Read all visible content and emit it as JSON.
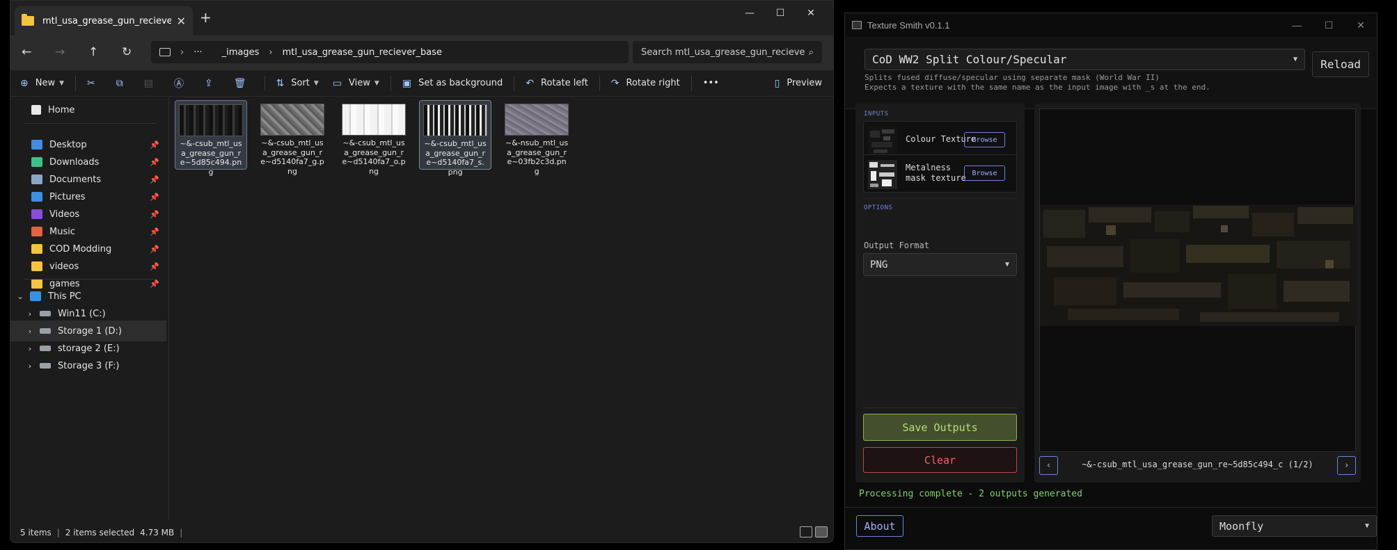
{
  "explorer": {
    "tab_title": "mtl_usa_grease_gun_reciever_",
    "tab_close": "✕",
    "new_tab": "+",
    "window_controls": {
      "minimize": "—",
      "maximize": "☐",
      "close": "✕"
    },
    "nav": {
      "back": "←",
      "forward": "→",
      "up": "↑",
      "refresh": "↻"
    },
    "breadcrumb": {
      "more": "···",
      "segments": [
        "_images",
        "mtl_usa_grease_gun_reciever_base"
      ]
    },
    "search_placeholder": "Search mtl_usa_grease_gun_recieve",
    "commands": {
      "new": "New",
      "sort": "Sort",
      "view": "View",
      "set_background": "Set as background",
      "rotate_left": "Rotate left",
      "rotate_right": "Rotate right",
      "more": "•••",
      "preview": "Preview"
    },
    "sidebar": {
      "home": "Home",
      "quick_access": [
        {
          "label": "Desktop",
          "color": "#3f8fe0"
        },
        {
          "label": "Downloads",
          "color": "#3fc28a"
        },
        {
          "label": "Documents",
          "color": "#8aa7c8"
        },
        {
          "label": "Pictures",
          "color": "#3f8fe0"
        },
        {
          "label": "Videos",
          "color": "#8a4fd8"
        },
        {
          "label": "Music",
          "color": "#e0643f"
        },
        {
          "label": "COD Modding",
          "color": "#f4c43e"
        },
        {
          "label": "videos",
          "color": "#f4c43e"
        },
        {
          "label": "games",
          "color": "#f4c43e"
        }
      ],
      "this_pc": "This PC",
      "drives": [
        {
          "label": "Win11 (C:)"
        },
        {
          "label": "Storage 1 (D:)"
        },
        {
          "label": "storage 2 (E:)"
        },
        {
          "label": "Storage 3 (F:)"
        }
      ]
    },
    "files": [
      {
        "name": "~&-csub_mtl_usa_grease_gun_re~5d85c494.png",
        "selected": true
      },
      {
        "name": "~&-csub_mtl_usa_grease_gun_re~d5140fa7_g.png",
        "selected": false
      },
      {
        "name": "~&-csub_mtl_usa_grease_gun_re~d5140fa7_o.png",
        "selected": false
      },
      {
        "name": "~&-csub_mtl_usa_grease_gun_re~d5140fa7_s.png",
        "selected": true
      },
      {
        "name": "~&-nsub_mtl_usa_grease_gun_re~03fb2c3d.png",
        "selected": false
      }
    ],
    "status": {
      "items": "5 items",
      "selected": "2 items selected",
      "size": "4.73 MB"
    }
  },
  "texture_smith": {
    "title": "Texture Smith v0.1.1",
    "preset": "CoD WW2 Split Colour/Specular",
    "description_line1": "Splits fused diffuse/specular using separate mask (World War II)",
    "description_line2": "Expects a texture with the same name as the input image with _s at the end.",
    "reload": "Reload",
    "inputs_header": "INPUTS",
    "inputs": [
      {
        "label": "Colour Texture",
        "button": "Browse"
      },
      {
        "label": "Metalness mask texture",
        "button": "Browse"
      }
    ],
    "options_header": "OPTIONS",
    "output_format_label": "Output Format",
    "output_format": "PNG",
    "save": "Save Outputs",
    "clear": "Clear",
    "preview_name": "~&-csub_mtl_usa_grease_gun_re~5d85c494_c (1/2)",
    "prev": "‹",
    "next": "›",
    "status": "Processing complete - 2 outputs generated",
    "about": "About",
    "theme": "Moonfly",
    "colors": {
      "accent": "#6f86d6",
      "success": "#7fd36a",
      "danger": "#e06a6a"
    }
  }
}
